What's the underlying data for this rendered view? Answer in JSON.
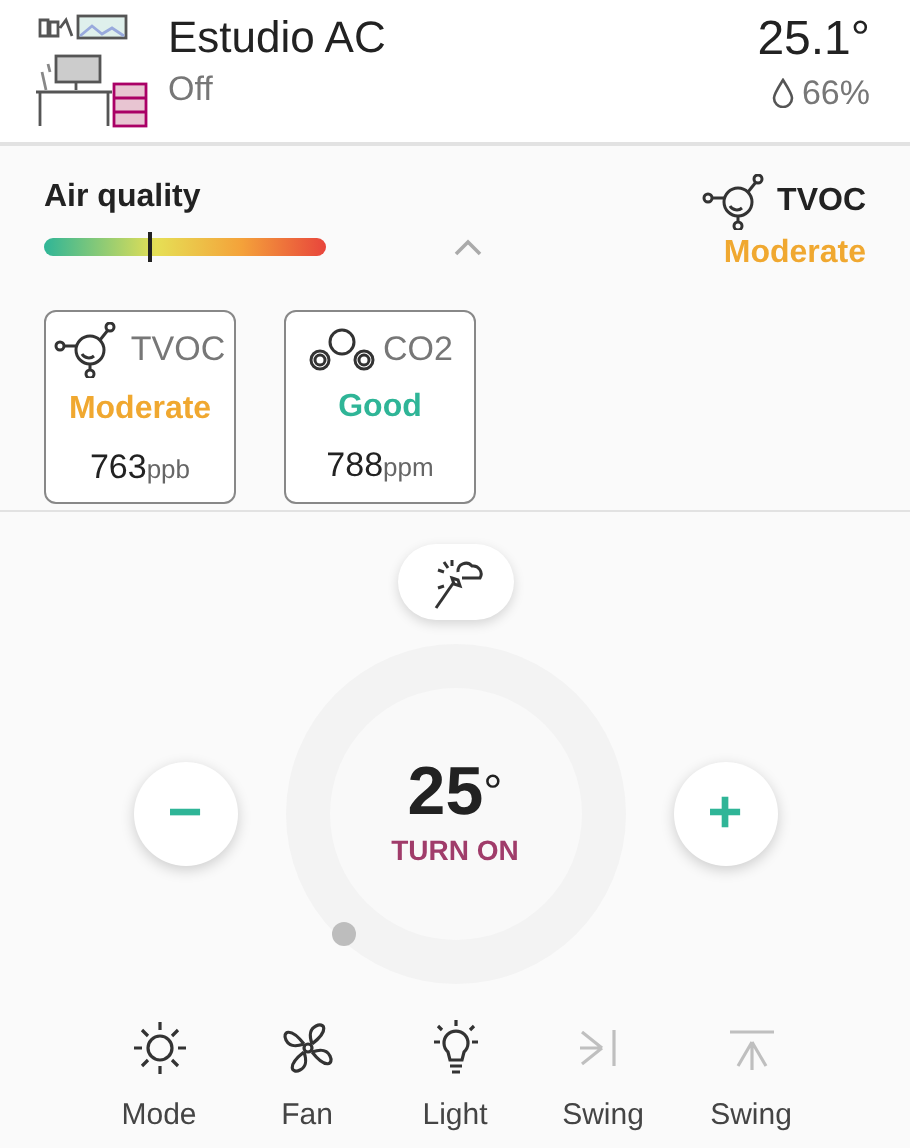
{
  "header": {
    "title": "Estudio AC",
    "status": "Off",
    "temperature": "25.1°",
    "humidity": "66%"
  },
  "air_quality": {
    "title": "Air quality",
    "level": 0.37,
    "expanded": true,
    "summary": {
      "kind": "tvoc",
      "name": "TVOC",
      "status": "Moderate",
      "color": "#f0a830"
    },
    "sensors": [
      {
        "kind": "tvoc",
        "name": "TVOC",
        "status": "Moderate",
        "color": "#f0a830",
        "value": "763",
        "unit": "ppb"
      },
      {
        "kind": "co2",
        "name": "CO2",
        "status": "Good",
        "color": "#2fb597",
        "value": "788",
        "unit": "ppm"
      }
    ]
  },
  "thermostat": {
    "setpoint": "25",
    "unit": "°",
    "action": "TURN ON",
    "minus": "−",
    "plus": "+"
  },
  "controls": [
    {
      "kind": "mode",
      "label": "Mode",
      "disabled": false
    },
    {
      "kind": "fan",
      "label": "Fan",
      "disabled": false
    },
    {
      "kind": "light",
      "label": "Light",
      "disabled": false
    },
    {
      "kind": "swing_v",
      "label": "Swing",
      "disabled": true
    },
    {
      "kind": "swing_h",
      "label": "Swing",
      "disabled": true
    }
  ]
}
